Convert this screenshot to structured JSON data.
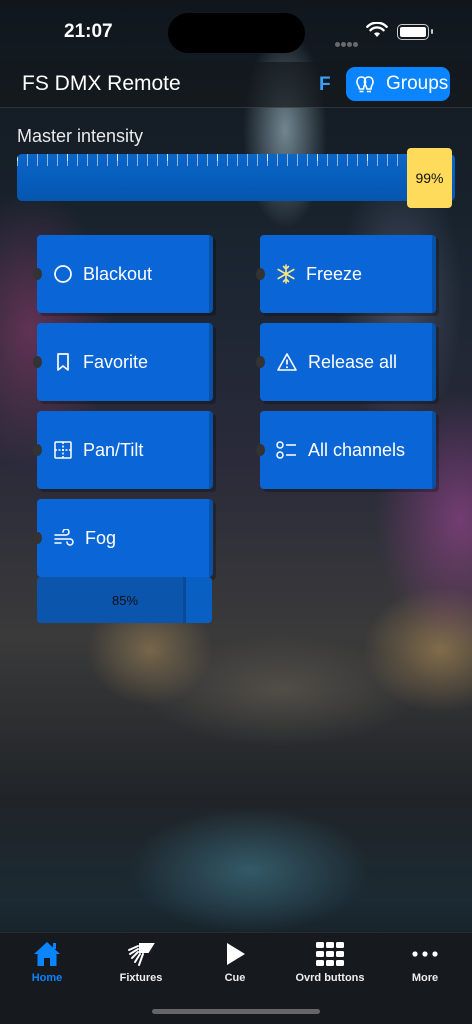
{
  "status": {
    "time": "21:07"
  },
  "nav": {
    "title": "FS DMX Remote",
    "badge": "F",
    "groups_label": "Groups"
  },
  "master": {
    "label": "Master intensity",
    "value": 0.99,
    "value_label": "99%"
  },
  "buttons": [
    {
      "label": "Blackout",
      "icon": "circle-icon",
      "active": false
    },
    {
      "label": "Freeze",
      "icon": "snowflake-icon",
      "active": true
    },
    {
      "label": "Favorite",
      "icon": "bookmark-icon",
      "active": false
    },
    {
      "label": "Release all",
      "icon": "warning-icon",
      "active": false
    },
    {
      "label": "Pan/Tilt",
      "icon": "crosshair-icon",
      "active": false
    },
    {
      "label": "All channels",
      "icon": "list-icon",
      "active": false
    },
    {
      "label": "Fog",
      "icon": "wind-icon",
      "active": false
    }
  ],
  "fog": {
    "value": 0.85,
    "value_label": "85%"
  },
  "tabs": [
    {
      "label": "Home",
      "icon": "house-icon",
      "selected": true
    },
    {
      "label": "Fixtures",
      "icon": "fixture-icon",
      "selected": false
    },
    {
      "label": "Cue",
      "icon": "play-icon",
      "selected": false
    },
    {
      "label": "Ovrd buttons",
      "icon": "grid-icon",
      "selected": false
    },
    {
      "label": "More",
      "icon": "ellipsis-icon",
      "selected": false
    }
  ],
  "colors": {
    "accent": "#0a84ff",
    "button": "#0a66d6",
    "thumb": "#ffdb5b",
    "active_border": "#ffd54a"
  }
}
